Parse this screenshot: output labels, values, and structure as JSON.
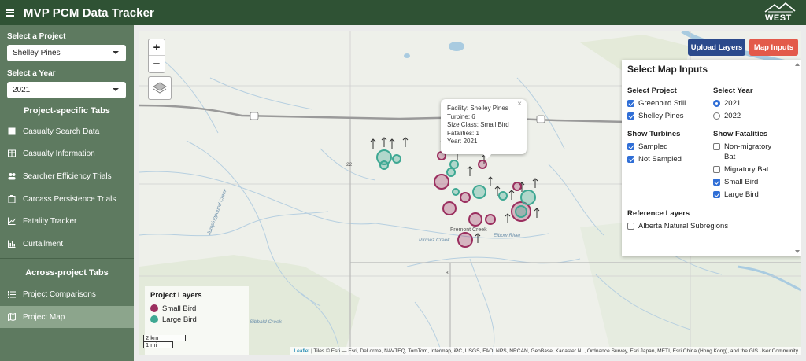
{
  "app": {
    "title": "MVP PCM Data Tracker",
    "logo_text": "WEST"
  },
  "sidebar": {
    "project_label": "Select a Project",
    "project_value": "Shelley Pines",
    "year_label": "Select a Year",
    "year_value": "2021",
    "section1": "Project-specific Tabs",
    "items": [
      {
        "label": "Casualty Search Data",
        "icon": "square-icon"
      },
      {
        "label": "Casualty Information",
        "icon": "table-icon"
      },
      {
        "label": "Searcher Efficiency Trials",
        "icon": "users-icon"
      },
      {
        "label": "Carcass Persistence Trials",
        "icon": "clipboard-icon"
      },
      {
        "label": "Fatality Tracker",
        "icon": "line-chart-icon"
      },
      {
        "label": "Curtailment",
        "icon": "bar-chart-icon"
      }
    ],
    "section2": "Across-project Tabs",
    "items2": [
      {
        "label": "Project Comparisons",
        "icon": "list-icon"
      },
      {
        "label": "Project Map",
        "icon": "map-icon",
        "active": true
      }
    ]
  },
  "map": {
    "zoom_in": "+",
    "zoom_out": "−",
    "upload_label": "Upload Layers",
    "map_inputs_label": "Map Inputs",
    "popup": {
      "close": "×",
      "facility": "Facility: Shelley Pines",
      "turbine": "Turbine: 6",
      "size_class": "Size Class: Small Bird",
      "fatalities": "Fatalities: 1",
      "year": "Year: 2021"
    },
    "places": {
      "hwy22": "22",
      "hwy8": "8",
      "town": "Fremont Creek",
      "river": "Elbow River",
      "creek1": "Pirmez Creek",
      "creek2": "Jumpingpound Creek",
      "creek3": "Sibbald Creek"
    },
    "legend": {
      "title": "Project Layers",
      "small": "Small Bird",
      "large": "Large Bird"
    },
    "scale": {
      "km": "2 km",
      "mi": "1 mi"
    },
    "attribution_link": "Leaflet",
    "attribution": " | Tiles © Esri — Esri, DeLorme, NAVTEQ, TomTom, Intermap, iPC, USGS, FAO, NPS, NRCAN, GeoBase, Kadaster NL, Ordnance Survey, Esri Japan, METI, Esri China (Hong Kong), and the GIS User Community"
  },
  "map_inputs": {
    "title": "Select Map Inputs",
    "project_head": "Select Project",
    "projects": [
      {
        "label": "Greenbird Still",
        "checked": true
      },
      {
        "label": "Shelley Pines",
        "checked": true
      }
    ],
    "year_head": "Select Year",
    "years": [
      {
        "label": "2021",
        "selected": true
      },
      {
        "label": "2022",
        "selected": false
      }
    ],
    "turbines_head": "Show Turbines",
    "turbines": [
      {
        "label": "Sampled",
        "checked": true
      },
      {
        "label": "Not Sampled",
        "checked": true
      }
    ],
    "fatalities_head": "Show Fatalities",
    "fatalities": [
      {
        "label": "Non-migratory",
        "label2": "Bat",
        "checked": false
      },
      {
        "label": "Migratory Bat",
        "checked": false
      },
      {
        "label": "Small Bird",
        "checked": true
      },
      {
        "label": "Large Bird",
        "checked": true
      }
    ],
    "reference_head": "Reference Layers",
    "reference": [
      {
        "label": "Alberta Natural Subregions",
        "checked": false
      }
    ]
  },
  "colors": {
    "header": "#2f5234",
    "sidebar": "#5e7a60",
    "small_bird": "#9b2f5f",
    "large_bird": "#3ea893",
    "upload": "#2b4a8c",
    "map_inputs": "#e35a4a"
  }
}
